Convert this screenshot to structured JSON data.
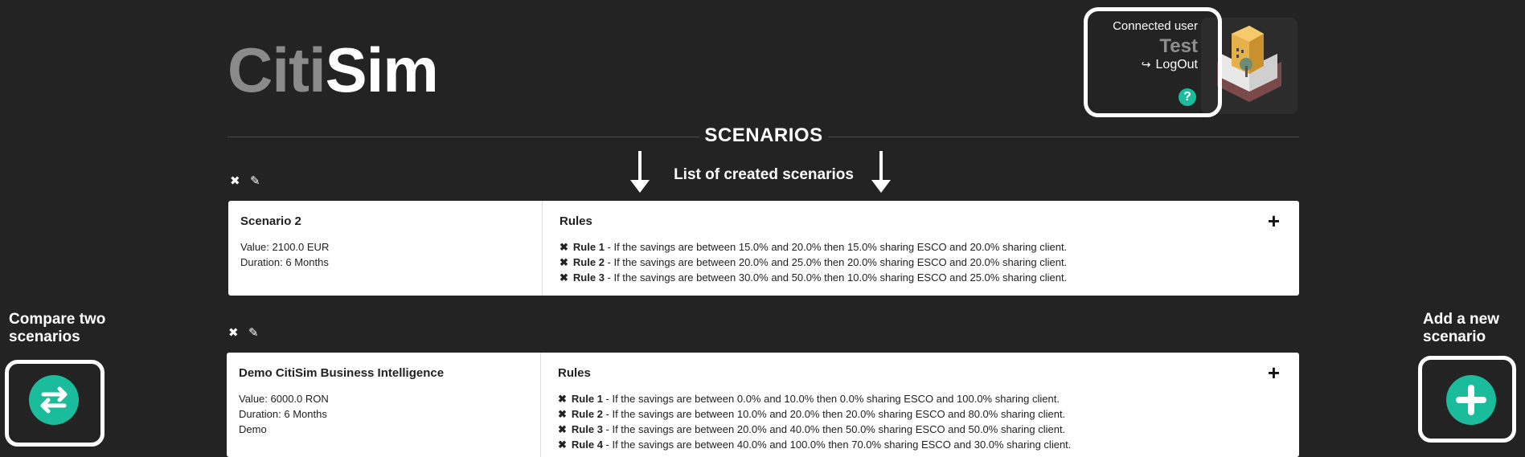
{
  "header": {
    "logo_part1": "Citi",
    "logo_part2": "Sim",
    "connected_label": "Connected user",
    "username": "Test",
    "logout_label": "LogOut",
    "help_symbol": "?"
  },
  "section": {
    "title": "SCENARIOS",
    "subtitle": "List of created  scenarios"
  },
  "scenarios": [
    {
      "name": "Scenario 2",
      "value": "Value: 2100.0 EUR",
      "duration": "Duration: 6 Months",
      "extra": "",
      "rules_title": "Rules",
      "rules": [
        {
          "label": "Rule 1",
          "text": " - If the savings are between 15.0% and 20.0% then 15.0% sharing ESCO and 20.0% sharing client."
        },
        {
          "label": "Rule 2",
          "text": " - If the savings are between 20.0% and 25.0% then 20.0% sharing ESCO and 20.0% sharing client."
        },
        {
          "label": "Rule 3",
          "text": " - If the savings are between 30.0% and 50.0% then 10.0% sharing ESCO and 25.0% sharing client."
        }
      ]
    },
    {
      "name": "Demo CitiSim Business Intelligence",
      "value": "Value: 6000.0 RON",
      "duration": "Duration: 6 Months",
      "extra": "Demo",
      "rules_title": "Rules",
      "rules": [
        {
          "label": "Rule 1",
          "text": " - If the savings are between 0.0% and 10.0% then 0.0% sharing ESCO and 100.0% sharing client."
        },
        {
          "label": "Rule 2",
          "text": " - If the savings are between 10.0% and 20.0% then 20.0% sharing ESCO and 80.0% sharing client."
        },
        {
          "label": "Rule 3",
          "text": " - If the savings are between 20.0% and 40.0% then 50.0% sharing ESCO and 50.0% sharing client."
        },
        {
          "label": "Rule 4",
          "text": " - If the savings are between 40.0% and 100.0% then 70.0% sharing ESCO and 30.0% sharing client."
        }
      ]
    }
  ],
  "compare": {
    "label_line1": "Compare two",
    "label_line2": "scenarios"
  },
  "add": {
    "label_line1": "Add a new",
    "label_line2": "scenario"
  },
  "colors": {
    "background": "#232323",
    "accent": "#1abc9c",
    "muted": "#8a8a8a"
  },
  "icons": {
    "delete": "times-icon",
    "edit": "edit-icon",
    "add_rule": "plus-icon",
    "compare": "swap-arrows-icon",
    "add_scenario": "plus-circle-icon",
    "logout": "sign-out-icon",
    "help": "question-circle-icon"
  }
}
